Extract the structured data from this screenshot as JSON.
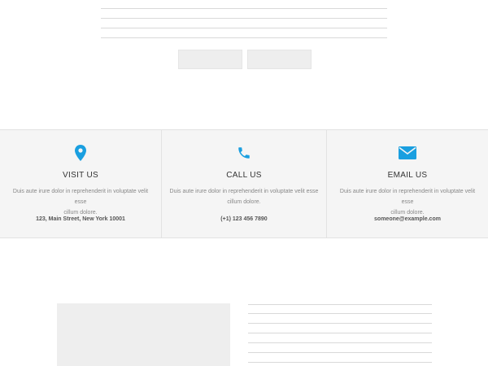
{
  "contact": {
    "items": [
      {
        "icon": "map-pin-icon",
        "title": "VISIT US",
        "desc_line1": "Duis aute irure dolor in reprehenderit in voluptate velit esse",
        "desc_line2": "cillum dolore.",
        "info": "123, Main Street, New York 10001"
      },
      {
        "icon": "phone-icon",
        "title": "CALL US",
        "desc_line1": "Duis aute irure dolor in reprehenderit in voluptate velit esse",
        "desc_line2": "cillum dolore.",
        "info": "(+1) 123 456 7890"
      },
      {
        "icon": "envelope-icon",
        "title": "EMAIL US",
        "desc_line1": "Duis aute irure dolor in reprehenderit in voluptate velit esse",
        "desc_line2": "cillum dolore.",
        "info": "someone@example.com"
      }
    ]
  },
  "colors": {
    "accent": "#1a9fe0",
    "strip_background": "#f5f5f5",
    "divider": "#e2e2e2"
  }
}
